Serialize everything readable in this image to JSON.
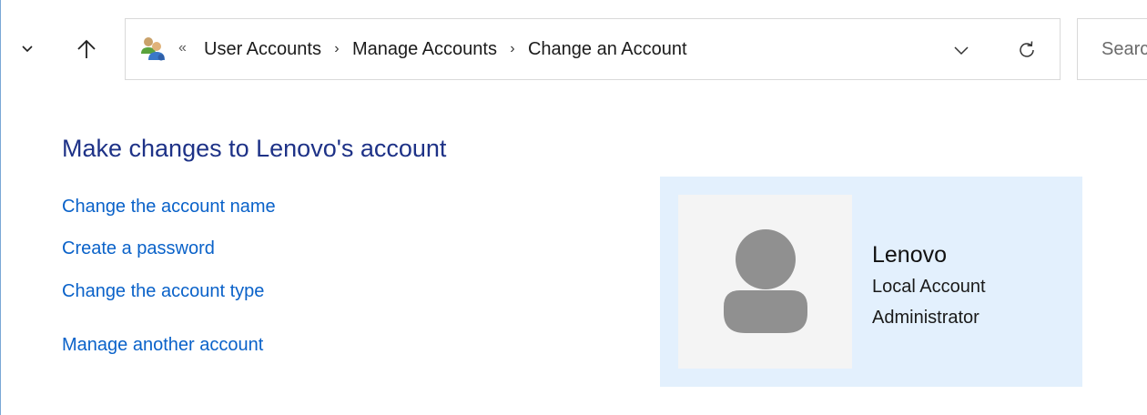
{
  "navigation": {
    "recent_icon": "chevron-down-icon",
    "up_icon": "up-arrow-icon"
  },
  "address_bar": {
    "location_icon": "user-accounts-icon",
    "overflow_glyph": "«",
    "breadcrumbs": [
      "User Accounts",
      "Manage Accounts",
      "Change an Account"
    ],
    "separator_glyph": "›",
    "dropdown_icon": "chevron-down-icon",
    "refresh_icon": "refresh-icon"
  },
  "search": {
    "placeholder": "Search"
  },
  "page": {
    "title": "Make changes to Lenovo's account",
    "links": [
      "Change the account name",
      "Create a password",
      "Change the account type",
      "Manage another account"
    ]
  },
  "account": {
    "name": "Lenovo",
    "type": "Local Account",
    "role": "Administrator",
    "avatar_icon": "user-avatar-icon"
  },
  "colors": {
    "title": "#1e3287",
    "link": "#0a62c9",
    "tile_background": "#e3f0fd",
    "avatar_background": "#f4f4f4",
    "avatar_silhouette": "#909090"
  }
}
